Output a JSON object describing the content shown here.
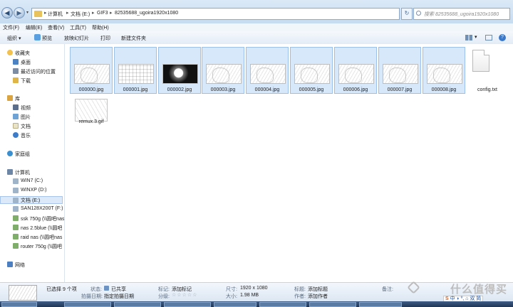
{
  "address": {
    "crumbs": [
      "计算机",
      "文档 (E:)",
      "GIF3",
      "82535688_ugoira1920x1080"
    ],
    "search_placeholder": "搜索 82535688_ugoira1920x1080"
  },
  "menu": [
    "文件(F)",
    "编辑(E)",
    "查看(V)",
    "工具(T)",
    "帮助(H)"
  ],
  "toolbar": {
    "organize": "组织 ▾",
    "preview": "预览",
    "slideshow": "放映幻灯片",
    "print": "打印",
    "new_folder": "新建文件夹"
  },
  "nav": {
    "favorites": "收藏夹",
    "desktop": "桌面",
    "recent": "最近访问的位置",
    "downloads": "下载",
    "library": "库",
    "videos": "视频",
    "pictures": "图片",
    "documents": "文档",
    "music": "音乐",
    "homegroup": "家庭组",
    "computer": "计算机",
    "drives": [
      "WIN7 (C:)",
      "WINXP (D:)",
      "文档 (E:)",
      "SAN128X200T (F:)",
      "ssk 750g (\\\\圆吧nas",
      "nas 2.5blue (\\\\圆吧",
      "raid nas (\\\\圆吧nas",
      "router 750g (\\\\圆吧"
    ],
    "network": "网络"
  },
  "files": [
    {
      "name": "000000.jpg",
      "kind": "sketch",
      "selected": true
    },
    {
      "name": "000001.jpg",
      "kind": "grid",
      "selected": true
    },
    {
      "name": "000002.jpg",
      "kind": "dark",
      "selected": true
    },
    {
      "name": "000003.jpg",
      "kind": "sketch",
      "selected": true
    },
    {
      "name": "000004.jpg",
      "kind": "sketch",
      "selected": true
    },
    {
      "name": "000005.jpg",
      "kind": "sketch",
      "selected": true
    },
    {
      "name": "000006.jpg",
      "kind": "sketch",
      "selected": true
    },
    {
      "name": "000007.jpg",
      "kind": "sketch",
      "selected": true
    },
    {
      "name": "000008.jpg",
      "kind": "sketch",
      "selected": true
    },
    {
      "name": "config.txt",
      "kind": "doc",
      "selected": false
    },
    {
      "name": "remux.3.gif",
      "kind": "gif",
      "selected": false
    }
  ],
  "details": {
    "selected_count": "已选择 9 个项",
    "state_label": "状态:",
    "state_value": "已共享",
    "date_label": "拍摄日期:",
    "date_value": "指定拍摄日期",
    "tags_label": "标记:",
    "tags_value": "添加标记",
    "rating_label": "分级:",
    "dims_label": "尺寸:",
    "dims_value": "1920 x 1080",
    "size_label": "大小:",
    "size_value": "1.98 MB",
    "title_label": "标题:",
    "title_value": "添加标题",
    "author_label": "作者:",
    "author_value": "添加作者",
    "note_label": "备注:"
  },
  "watermark": "什么值得买",
  "ime": "中 ◗ º, ⌂ 双 简"
}
